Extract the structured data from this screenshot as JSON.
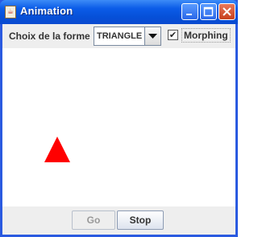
{
  "window": {
    "title": "Animation",
    "app_icon": "java-cup-icon"
  },
  "toolbar": {
    "shape_label": "Choix de la forme",
    "shape_select": {
      "value": "TRIANGLE"
    },
    "morphing": {
      "label": "Morphing",
      "checked": true,
      "check_glyph": "✔"
    }
  },
  "canvas": {
    "shape": "triangle",
    "color": "#ff0000"
  },
  "buttons": {
    "go": {
      "label": "Go",
      "enabled": false
    },
    "stop": {
      "label": "Stop",
      "enabled": true
    }
  }
}
